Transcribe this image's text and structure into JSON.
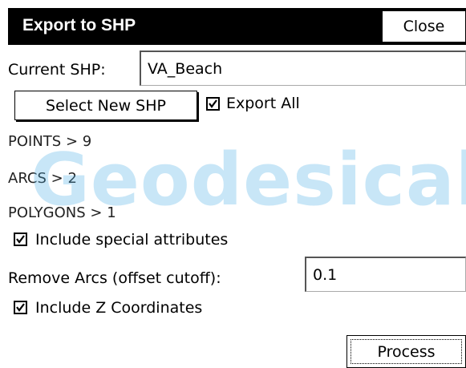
{
  "window": {
    "title": "Export to SHP",
    "close_label": "Close"
  },
  "shp": {
    "current_label": "Current SHP:",
    "current_value": "VA_Beach",
    "select_button_label": "Select New SHP",
    "export_all_label": "Export All",
    "export_all_checked": true
  },
  "summary": {
    "points": "POINTS > 9",
    "arcs": "ARCS > 2",
    "polygons": "POLYGONS > 1"
  },
  "options": {
    "special_attributes_label": "Include special attributes",
    "special_attributes_checked": true,
    "remove_arcs_label": "Remove Arcs (offset cutoff):",
    "remove_arcs_value": "0.1",
    "z_coordinates_label": "Include Z Coordinates",
    "z_coordinates_checked": true
  },
  "actions": {
    "process_label": "Process"
  },
  "watermark": {
    "text": "Geodesical"
  },
  "colors": {
    "titlebar": "#000000",
    "watermark": "#4db0e6"
  }
}
